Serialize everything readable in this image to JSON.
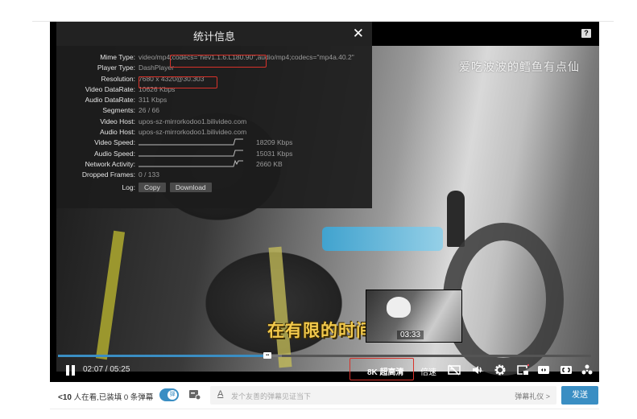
{
  "player": {
    "help_label": "?",
    "watermark": "爱吃波波的鳕鱼有点仙",
    "subtitle": "在有限的时间",
    "thumbnail_time": "03:33",
    "progress_fraction": 0.393,
    "buffered_fraction": 0.42
  },
  "stats_panel": {
    "title": "统计信息",
    "close_label": "✕",
    "rows": [
      {
        "label": "Mime Type:",
        "value": "video/mp4;codecs=\"hev1.1.6.L180.90\",audio/mp4;codecs=\"mp4a.40.2\""
      },
      {
        "label": "Player Type:",
        "value": "DashPlayer"
      },
      {
        "label": "Resolution:",
        "value": "7680 x 4320@30.303"
      },
      {
        "label": "Video DataRate:",
        "value": "10626 Kbps"
      },
      {
        "label": "Audio DataRate:",
        "value": "311 Kbps"
      },
      {
        "label": "Segments:",
        "value": "26 / 66"
      },
      {
        "label": "Video Host:",
        "value": "upos-sz-mirrorkodoo1.bilivideo.com"
      },
      {
        "label": "Audio Host:",
        "value": "upos-sz-mirrorkodoo1.bilivideo.com"
      }
    ],
    "graphs": [
      {
        "label": "Video Speed:",
        "value": "18209 Kbps"
      },
      {
        "label": "Audio Speed:",
        "value": "15031 Kbps"
      },
      {
        "label": "Network Activity:",
        "value": "2660 KB"
      }
    ],
    "dropped_frames": {
      "label": "Dropped Frames:",
      "value": "0 / 133"
    },
    "log": {
      "label": "Log:",
      "copy_label": "Copy",
      "download_label": "Download"
    }
  },
  "controls": {
    "time_current": "02:07",
    "time_separator": " / ",
    "time_total": "05:25",
    "quality": "8K 超高清",
    "speed": "倍速"
  },
  "danmaku_bar": {
    "viewers_count": "<10",
    "viewers_text": " 人在看,已装填 0 条弹幕",
    "toggle_label": "弹",
    "font_icon_label": "A",
    "placeholder": "发个友善的弹幕见证当下",
    "etiquette": "弹幕礼仪 >",
    "send_label": "发送"
  },
  "colors": {
    "accent": "#3a8ec3",
    "highlight_box": "#d8322a",
    "subtitle": "#f2c94c"
  }
}
